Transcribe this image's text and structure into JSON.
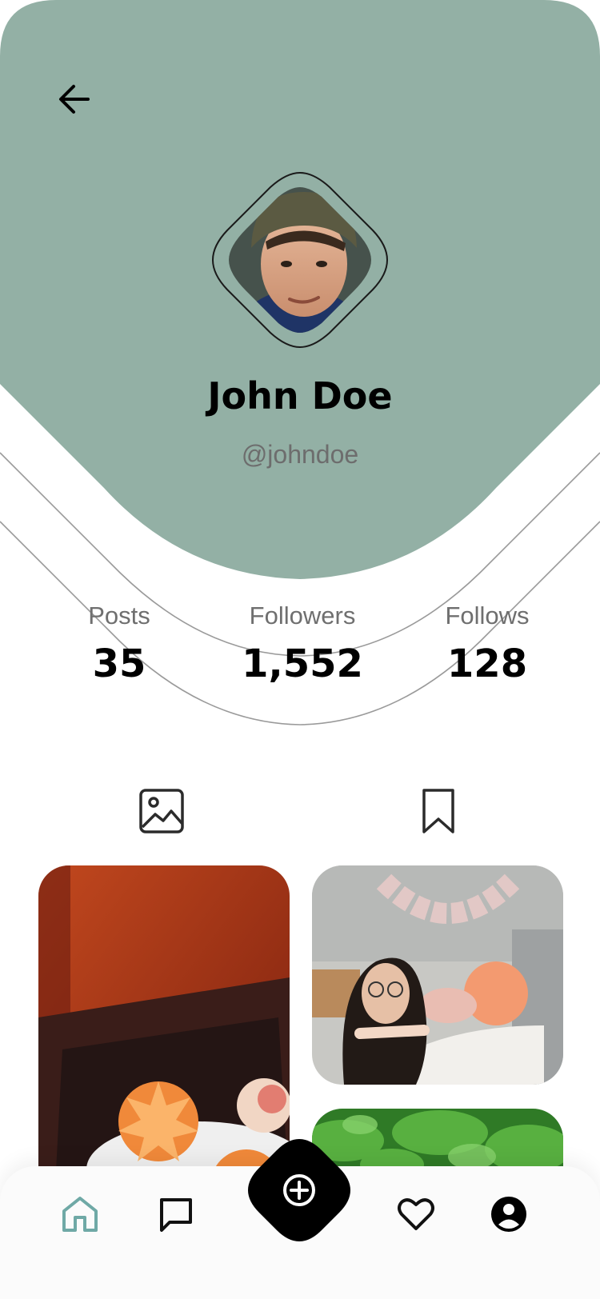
{
  "profile": {
    "name": "John Doe",
    "handle": "@johndoe"
  },
  "stats": [
    {
      "label": "Posts",
      "value": "35"
    },
    {
      "label": "Followers",
      "value": "1,552"
    },
    {
      "label": "Follows",
      "value": "128"
    }
  ],
  "colors": {
    "header_bg": "#93b0a5",
    "accent": "#6fa9a6",
    "text": "#000000",
    "muted": "#6f6f6f"
  },
  "tabs": [
    {
      "icon": "image-icon",
      "active": true
    },
    {
      "icon": "bookmark-icon",
      "active": false
    }
  ],
  "bottom_nav": [
    {
      "icon": "home-icon",
      "active": true
    },
    {
      "icon": "chat-icon",
      "active": false
    },
    {
      "icon": "plus-circle-icon",
      "active": false
    },
    {
      "icon": "heart-icon",
      "active": false
    },
    {
      "icon": "user-icon",
      "active": false
    }
  ]
}
